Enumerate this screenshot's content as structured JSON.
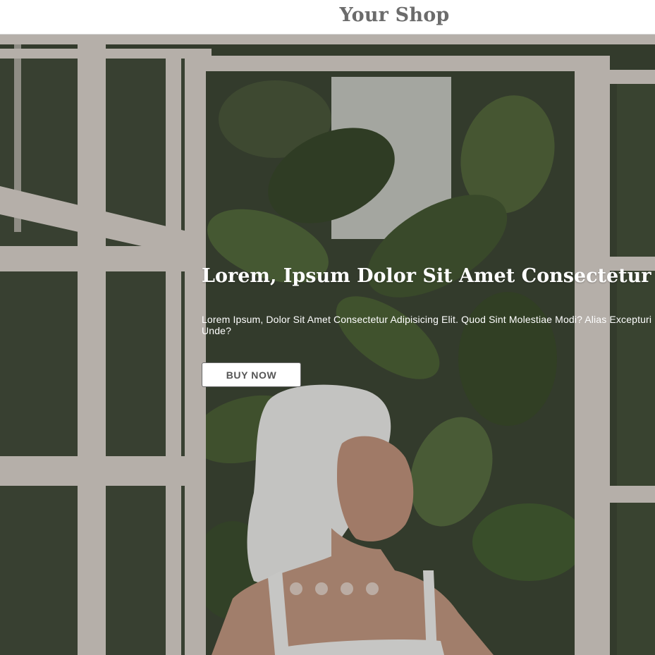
{
  "header": {
    "brand": "Your Shop"
  },
  "hero": {
    "title": "Lorem, Ipsum Dolor Sit Amet Consectetur Adipisicing Elit.",
    "subtitle": "Lorem Ipsum, Dolor Sit Amet Consectetur Adipisicing Elit. Quod Sint Molestiae Modi? Alias Excepturi Unde?",
    "button_label": "BUY NOW",
    "slide_count": 4
  },
  "colors": {
    "brand_text": "#6b6b6b",
    "button_bg": "#ffffff",
    "button_text": "#555555",
    "hero_text": "#ffffff"
  }
}
